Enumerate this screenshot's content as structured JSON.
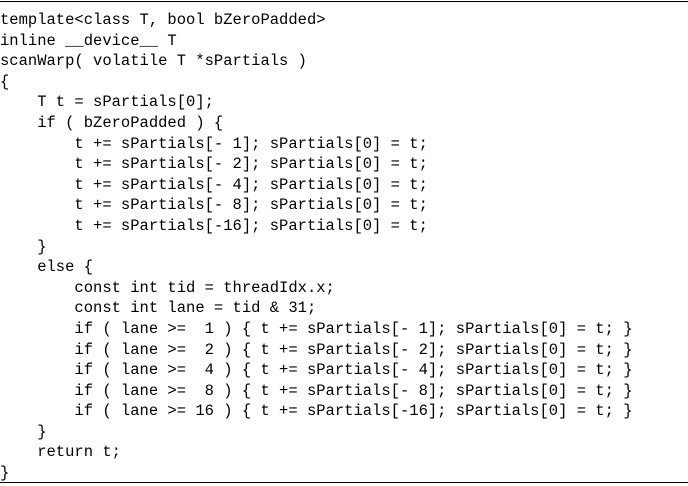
{
  "code_listing": {
    "lines": [
      "template<class T, bool bZeroPadded>",
      "inline __device__ T",
      "scanWarp( volatile T *sPartials )",
      "{",
      "    T t = sPartials[0];",
      "    if ( bZeroPadded ) {",
      "        t += sPartials[- 1]; sPartials[0] = t;",
      "        t += sPartials[- 2]; sPartials[0] = t;",
      "        t += sPartials[- 4]; sPartials[0] = t;",
      "        t += sPartials[- 8]; sPartials[0] = t;",
      "        t += sPartials[-16]; sPartials[0] = t;",
      "    }",
      "    else {",
      "        const int tid = threadIdx.x;",
      "        const int lane = tid & 31;",
      "        if ( lane >=  1 ) { t += sPartials[- 1]; sPartials[0] = t; }",
      "        if ( lane >=  2 ) { t += sPartials[- 2]; sPartials[0] = t; }",
      "        if ( lane >=  4 ) { t += sPartials[- 4]; sPartials[0] = t; }",
      "        if ( lane >=  8 ) { t += sPartials[- 8]; sPartials[0] = t; }",
      "        if ( lane >= 16 ) { t += sPartials[-16]; sPartials[0] = t; }",
      "    }",
      "    return t;",
      "}"
    ]
  }
}
